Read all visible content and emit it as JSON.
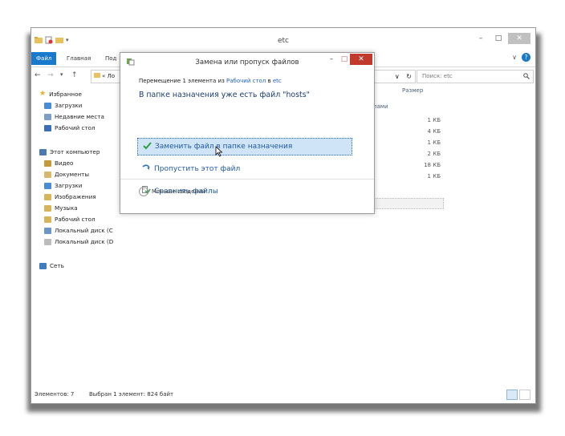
{
  "window": {
    "title": "etc",
    "controls": {
      "minimize": "–",
      "maximize": "□",
      "close": "✕"
    }
  },
  "ribbon": {
    "tabs": [
      "Файл",
      "Главная",
      "Под"
    ],
    "collapse": "∨",
    "help": "?"
  },
  "address": {
    "back": "←",
    "forward": "→",
    "dropdown": "▾",
    "up": "↑",
    "path": "« Ло",
    "history": "∨",
    "refresh": "↻",
    "search_placeholder": "Поиск: etc",
    "search_icon": "search-icon"
  },
  "navigation": {
    "favorites": "Избранное",
    "favorites_items": [
      "Загрузки",
      "Недавние места",
      "Рабочий стол"
    ],
    "this_pc": "Этот компьютер",
    "pc_items": [
      "Видео",
      "Документы",
      "Загрузки",
      "Изображения",
      "Музыка",
      "Рабочий стол",
      "Локальный диск (C",
      "Локальный диск (D"
    ],
    "network": "Сеть"
  },
  "file_list": {
    "col_partial": "лами",
    "col_size": "Размер",
    "sizes": [
      "1 КБ",
      "4 КБ",
      "1 КБ",
      "2 КБ",
      "18 КБ",
      "1 КБ"
    ]
  },
  "status": {
    "count": "Элементов: 7",
    "selection": "Выбран 1 элемент: 824 байт"
  },
  "dialog": {
    "title": "Замена или пропуск файлов",
    "min": "–",
    "max": "□",
    "close": "✕",
    "subtitle_prefix": "Перемещение 1 элемента из ",
    "subtitle_from": "Рабочий стол",
    "subtitle_mid": " в ",
    "subtitle_to": "etc",
    "heading": "В папке назначения уже есть файл \"hosts\"",
    "options": [
      {
        "label": "Заменить файл в папке назначения",
        "icon": "check-icon",
        "selected": true
      },
      {
        "label": "Пропустить этот файл",
        "icon": "skip-arrow-icon",
        "selected": false
      },
      {
        "label": "Сравнить файлы",
        "icon": "compare-icon",
        "selected": false
      }
    ],
    "less_details": "Меньше сведений"
  },
  "colors": {
    "accent": "#1979ca",
    "link": "#1f62c4",
    "option_text": "#1f5aa8",
    "close_red": "#c0392b",
    "selection_bg": "#cfe4f7"
  }
}
